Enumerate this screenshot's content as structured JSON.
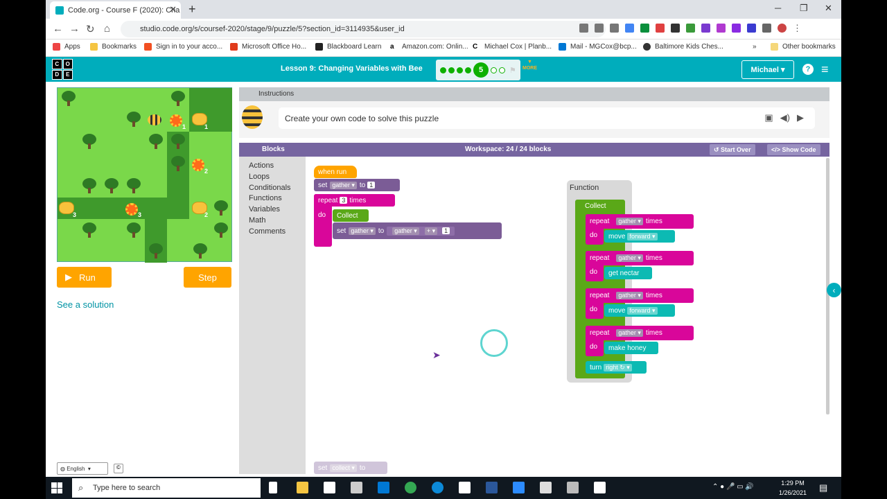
{
  "browser": {
    "tab_title": "Code.org - Course F (2020): Cha",
    "url": "studio.code.org/s/coursef-2020/stage/9/puzzle/5?section_id=3114935&user_id"
  },
  "bookmarks": [
    "Apps",
    "Bookmarks",
    "Sign in to your acco...",
    "Microsoft Office Ho...",
    "Blackboard Learn",
    "Amazon.com: Onlin...",
    "Michael Cox | Planb...",
    "Mail - MGCox@bcp...",
    "Baltimore Kids Ches...",
    "Other bookmarks"
  ],
  "header": {
    "logo_letters": [
      "C",
      "O",
      "D",
      "E"
    ],
    "lesson_title": "Lesson 9: Changing Variables with Bee",
    "current_level": "5",
    "more_label": "MORE",
    "user_name": "Michael",
    "help": "?"
  },
  "maze": {
    "flower_counts": [
      "1",
      "1",
      "2",
      "3",
      "3",
      "2"
    ],
    "run_label": "Run",
    "step_label": "Step",
    "solution_link": "See a solution",
    "language": "English"
  },
  "instructions": {
    "header": "Instructions",
    "text": "Create your own code to solve this puzzle"
  },
  "toolbar": {
    "blocks_label": "Blocks",
    "workspace_label": "Workspace: 24 / 24 blocks",
    "start_over": "Start Over",
    "show_code": "Show Code"
  },
  "toolbox": [
    "Actions",
    "Loops",
    "Conditionals",
    "Functions",
    "Variables",
    "Math",
    "Comments"
  ],
  "blocks": {
    "when_run": "when run",
    "set": "set",
    "to": "to",
    "gather": "gather",
    "one": "1",
    "three": "3",
    "repeat": "repeat",
    "times": "times",
    "do": "do",
    "collect": "Collect",
    "plus": "+",
    "function_label": "Function",
    "move": "move",
    "forward": "forward",
    "get_nectar": "get nectar",
    "make_honey": "make honey",
    "turn": "turn",
    "right": "right ↻",
    "ghost_var": "collect"
  },
  "taskbar": {
    "search_placeholder": "Type here to search",
    "time": "1:29 PM",
    "date": "1/26/2021"
  }
}
